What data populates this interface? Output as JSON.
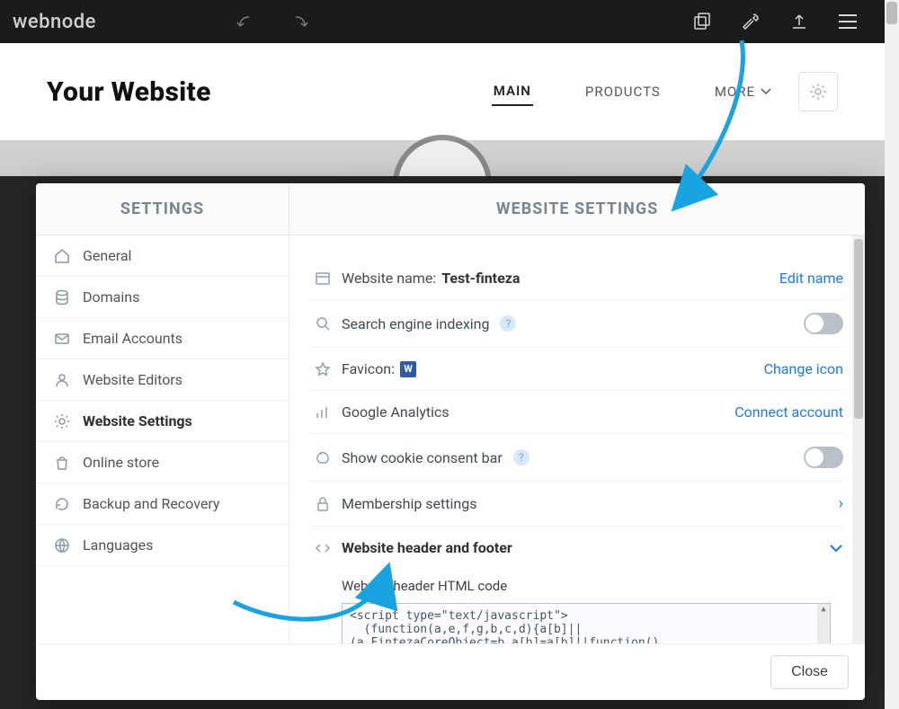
{
  "brand": "webnode",
  "page_title": "Your Website",
  "nav": {
    "main": "MAIN",
    "products": "PRODUCTS",
    "more": "MORE"
  },
  "modal": {
    "sidebar_title": "SETTINGS",
    "content_title": "WEBSITE SETTINGS",
    "close": "Close"
  },
  "sidebar": {
    "general": "General",
    "domains": "Domains",
    "email": "Email Accounts",
    "editors": "Website Editors",
    "settings": "Website Settings",
    "store": "Online store",
    "backup": "Backup and Recovery",
    "languages": "Languages"
  },
  "settings": {
    "name_label": "Website name:",
    "name_value": "Test-finteza",
    "edit_name": "Edit name",
    "indexing": "Search engine indexing",
    "favicon_label": "Favicon:",
    "favicon_badge": "W",
    "change_icon": "Change icon",
    "analytics": "Google Analytics",
    "connect": "Connect account",
    "cookie": "Show cookie consent bar",
    "membership": "Membership settings",
    "header_footer": "Website header and footer",
    "header_html_label": "Website header HTML code",
    "code_line1": "<script type=\"text/javascript\">",
    "code_line2": "  (function(a,e,f,g,b,c,d){a[b]||",
    "code_line3": "(a.FintezaCoreObject=b,a[b]=a[b]||function()"
  }
}
